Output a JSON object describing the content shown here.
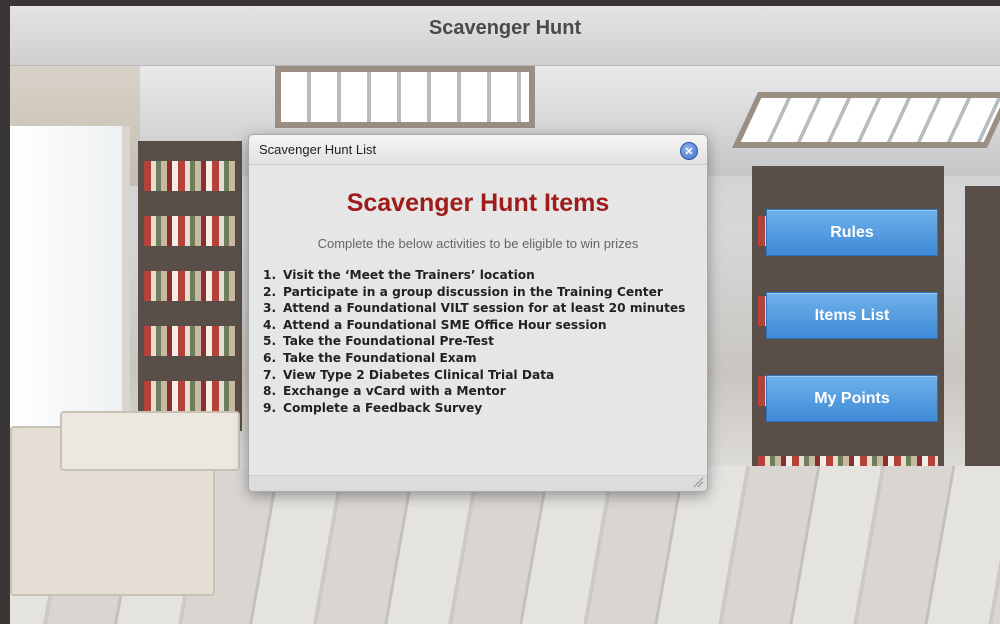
{
  "app": {
    "title": "Scavenger Hunt"
  },
  "dialog": {
    "title": "Scavenger Hunt List",
    "close_icon": "close-icon",
    "heading": "Scavenger Hunt Items",
    "subtitle": "Complete the below activities to be eligible to win prizes",
    "items": [
      {
        "num": "1.",
        "text": "Visit the ‘Meet the Trainers’ location"
      },
      {
        "num": "2.",
        "text": "Participate in a group discussion in the Training Center"
      },
      {
        "num": "3.",
        "text": "Attend a Foundational VILT session for at least 20 minutes"
      },
      {
        "num": "4.",
        "text": "Attend a Foundational SME Office Hour session"
      },
      {
        "num": "5.",
        "text": "Take the Foundational Pre-Test"
      },
      {
        "num": "6.",
        "text": "Take the Foundational Exam"
      },
      {
        "num": "7.",
        "text": "View Type 2 Diabetes Clinical Trial Data"
      },
      {
        "num": "8.",
        "text": "Exchange a vCard with a Mentor"
      },
      {
        "num": "9.",
        "text": "Complete a Feedback Survey"
      }
    ]
  },
  "side_menu": {
    "rules_label": "Rules",
    "items_list_label": "Items List",
    "my_points_label": "My Points"
  },
  "colors": {
    "heading_red": "#a01c1c",
    "button_blue": "#4f97dd",
    "frame_dark": "#3a3635"
  }
}
